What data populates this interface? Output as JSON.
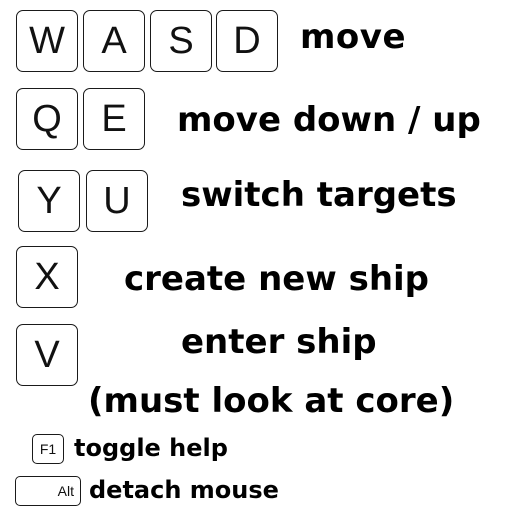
{
  "keys": {
    "w": "W",
    "a": "A",
    "s": "S",
    "d": "D",
    "q": "Q",
    "e": "E",
    "y": "Y",
    "u": "U",
    "x": "X",
    "v": "V",
    "f1": "F1",
    "alt": "Alt"
  },
  "descriptions": {
    "move": "move",
    "move_down_up": "move down / up",
    "switch_targets": "switch targets",
    "create_new_ship": "create new ship",
    "enter_ship": "enter ship",
    "enter_ship_note": "(must look at core)",
    "toggle_help": "toggle help",
    "detach_mouse": "detach mouse"
  }
}
